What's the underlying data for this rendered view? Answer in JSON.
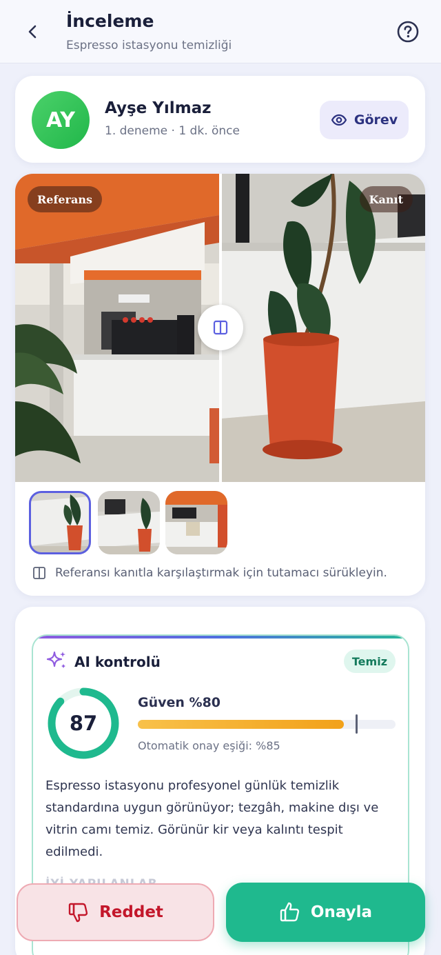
{
  "header": {
    "title": "İnceleme",
    "subtitle": "Espresso istasyonu temizliği",
    "back_icon": "chevron-left-icon",
    "help_icon": "question-circle-icon"
  },
  "submitter": {
    "initials": "AY",
    "name": "Ayşe Yılmaz",
    "meta": "1. deneme · 1 dk. önce",
    "task_button": "Görev"
  },
  "comparison": {
    "reference_label": "Referans",
    "proof_label": "Kanıt",
    "hint": "Referansı kanıtla karşılaştırmak için tutamacı sürükleyin.",
    "thumbnail_count": 3,
    "active_thumbnail": 1
  },
  "ai_check": {
    "title": "AI kontrolü",
    "status_badge": "Temiz",
    "score": "87",
    "score_fraction": 0.87,
    "confidence_label": "Güven %80",
    "confidence_value": 0.8,
    "threshold_value": 0.85,
    "threshold_text": "Otomatik onay eşiği: %85",
    "summary": "Espresso istasyonu profesyonel günlük temizlik standardına uygun görünüyor; tezgâh, makine dışı ve vitrin camı temiz. Görünür kir veya kalıntı tespit edilmedi.",
    "done_well_heading": "İYİ YAPILANLAR"
  },
  "actions": {
    "reject_label": "Reddet",
    "approve_label": "Onayla"
  },
  "colors": {
    "accent": "#5b5fe0",
    "approve": "#1fb98e",
    "reject": "#c3172b",
    "confidence": "#f2a11a"
  }
}
